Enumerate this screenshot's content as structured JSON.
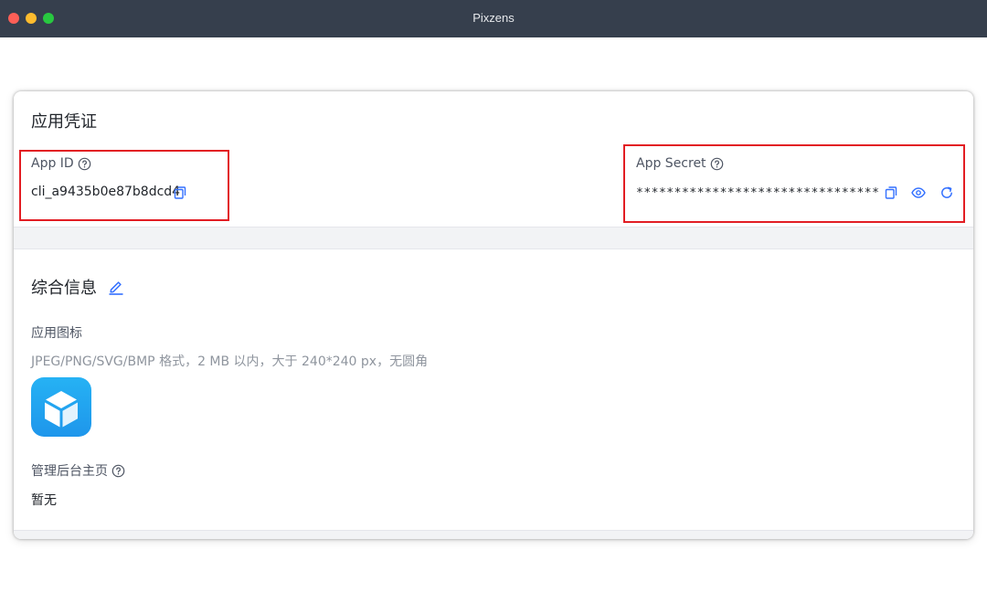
{
  "window": {
    "title": "Pixzens"
  },
  "credentials": {
    "title": "应用凭证",
    "app_id": {
      "label": "App ID",
      "value": "cli_a9435b0e87b8dcd4"
    },
    "app_secret": {
      "label": "App Secret",
      "value": "********************************"
    }
  },
  "general": {
    "title": "综合信息",
    "icon_label": "应用图标",
    "icon_hint": "JPEG/PNG/SVG/BMP 格式，2 MB 以内，大于 240*240 px，无圆角",
    "homepage_label": "管理后台主页",
    "homepage_value": "暂无"
  },
  "icons": {
    "help": "help-circle-icon",
    "copy": "copy-icon",
    "view": "eye-icon",
    "refresh": "refresh-icon",
    "edit": "edit-icon",
    "app": "cube-icon"
  },
  "colors": {
    "accent": "#3370ff",
    "highlight_box": "#e21d23",
    "titlebar": "#363f4d",
    "app_icon": "#1e96eb"
  }
}
